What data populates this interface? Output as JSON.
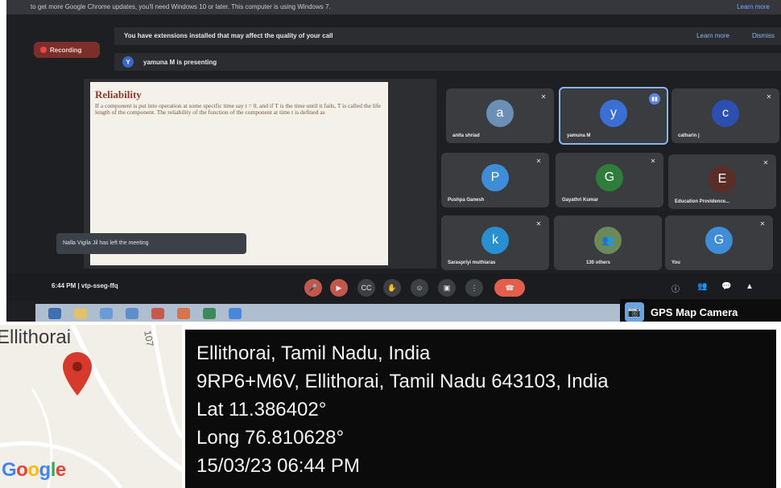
{
  "screen": {
    "top_bar": {
      "text": "to get more Google Chrome updates, you'll need Windows 10 or later. This computer is using Windows 7.",
      "action": "Learn more"
    },
    "recording_label": "Recording",
    "extension_banner": {
      "text": "You have extensions installed that may affect the quality of your call",
      "learn_more": "Learn more",
      "dismiss": "Dismiss"
    },
    "presenting": {
      "avatar": "Y",
      "text": "yamuna M is presenting"
    },
    "slide": {
      "title": "Reliability",
      "body": "If a component is put into operation at some specific time say t = 0, and if T is the time until it fails, T is called the life length of the component. The reliability of the function of the component at time t is defined as"
    },
    "toast": "Nalla Vigila Jil has left the meeting",
    "participants": [
      {
        "initial": "a",
        "name": "anita shriad",
        "color": "#6b8fb5"
      },
      {
        "initial": "y",
        "name": "yamuna M",
        "color": "#3b6fd6"
      },
      {
        "initial": "c",
        "name": "catharin j",
        "color": "#2d4fb0"
      },
      {
        "initial": "P",
        "name": "Pushpa Ganesh",
        "color": "#3f8cd8"
      },
      {
        "initial": "G",
        "name": "Gayathri Kumar",
        "color": "#2f7d3a"
      },
      {
        "initial": "E",
        "name": "Education Providence...",
        "color": "#5a2e27"
      },
      {
        "initial": "k",
        "name": "Saraspriyi muthiaras",
        "color": "#2a8fd0"
      },
      {
        "initial": "",
        "name": "130 others",
        "color": "#3a3c40"
      },
      {
        "initial": "G",
        "name": "You",
        "color": "#3f8cd8"
      }
    ],
    "controls": {
      "time_code": "6:44 PM  |  vtp-sseg-ffq"
    },
    "gps_badge": "GPS Map Camera"
  },
  "geotag": {
    "map_place": "Ellithorai",
    "map_road_number": "107",
    "google_logo": "Google",
    "line1": "Ellithorai, Tamil Nadu, India",
    "line2": "9RP6+M6V, Ellithorai, Tamil Nadu 643103, India",
    "lat": "Lat 11.386402°",
    "long": "Long 76.810628°",
    "datetime": "15/03/23 06:44 PM"
  },
  "colors": {
    "meet_bg": "#1e1f22",
    "tile": "#3a3c40",
    "highlight": "#8ab4f8",
    "end_call": "#e35e4d",
    "marker": "#d63a2d"
  }
}
